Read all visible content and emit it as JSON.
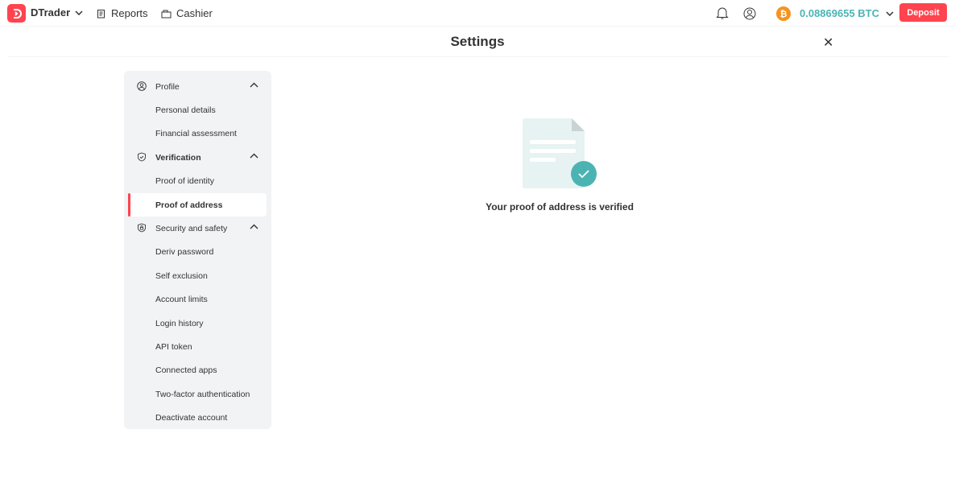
{
  "header": {
    "app_name": "DTrader",
    "reports": "Reports",
    "cashier": "Cashier",
    "balance": "0.08869655 BTC",
    "deposit": "Deposit"
  },
  "page": {
    "title": "Settings",
    "message": "Your proof of address is verified"
  },
  "sidebar": {
    "profile": "Profile",
    "personal_details": "Personal details",
    "financial_assessment": "Financial assessment",
    "verification": "Verification",
    "proof_of_identity": "Proof of identity",
    "proof_of_address": "Proof of address",
    "security": "Security and safety",
    "deriv_password": "Deriv password",
    "self_exclusion": "Self exclusion",
    "account_limits": "Account limits",
    "login_history": "Login history",
    "api_token": "API token",
    "connected_apps": "Connected apps",
    "two_factor": "Two-factor authentication",
    "deactivate": "Deactivate account"
  },
  "colors": {
    "brand": "#ff444f",
    "accent": "#4bb4b3",
    "btc": "#f7931a"
  }
}
